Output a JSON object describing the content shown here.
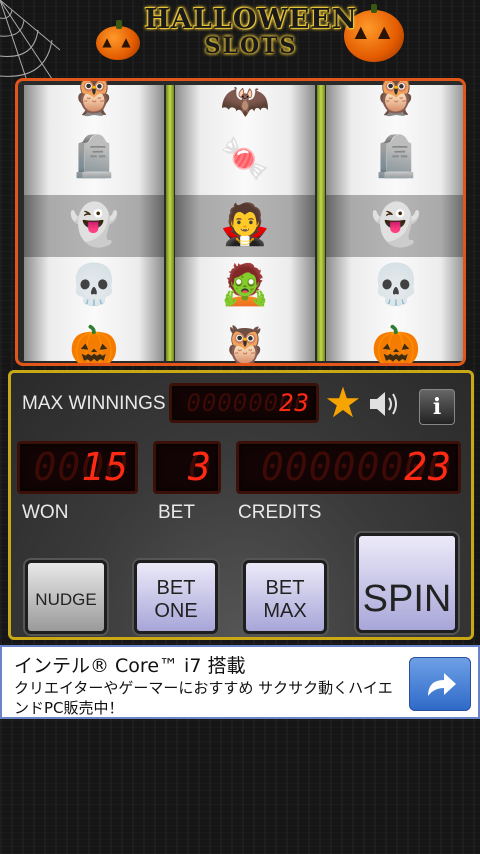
{
  "header": {
    "title": "HALLOWEEN",
    "subtitle": "SLOTS"
  },
  "reels": [
    {
      "symbols": [
        "owl-icon",
        "tombstone-icon",
        "ghost-icon",
        "skeleton-icon",
        "pumpkin-icon"
      ]
    },
    {
      "symbols": [
        "bat-icon",
        "trick-or-treat-icon",
        "vampire-icon",
        "frankenstein-icon",
        "owl-icon"
      ]
    },
    {
      "symbols": [
        "owl-icon",
        "tombstone-icon",
        "ghost-icon",
        "skeleton-icon",
        "pumpkin-icon"
      ]
    }
  ],
  "stats": {
    "max_winnings_label": "MAX WINNINGS",
    "max_winnings_value": "23",
    "won_label": "WON",
    "won_value": "15",
    "bet_label": "BET",
    "bet_value": "3",
    "credits_label": "CREDITS",
    "credits_value": "23"
  },
  "buttons": {
    "nudge": "NUDGE",
    "bet_one_line1": "BET",
    "bet_one_line2": "ONE",
    "bet_max_line1": "BET",
    "bet_max_line2": "MAX",
    "spin": "SPIN",
    "info": "i"
  },
  "ad": {
    "title": "インテル® Core™ i7 搭載",
    "text": "クリエイターやゲーマーにおすすめ サクサク動くハイエンドPC販売中！"
  },
  "colors": {
    "frame": "#e2561a",
    "panel_border": "#c9a816",
    "led_red": "#ff2a14",
    "reel_separator": "#c8d64a"
  }
}
